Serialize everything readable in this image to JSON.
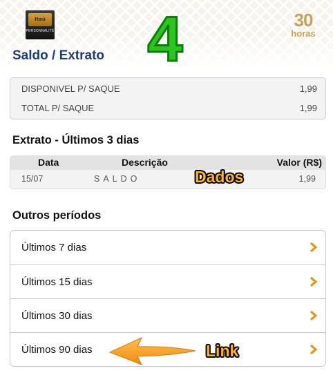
{
  "header": {
    "logo_brand": "Itaú",
    "logo_sub": "PERSONNALITÉ",
    "hours_number": "30",
    "hours_label": "horas",
    "annotation_number": "4"
  },
  "page_title": "Saldo / Extrato",
  "balance": {
    "rows": [
      {
        "label": "DISPONIVEL P/ SAQUE",
        "value": "1,99"
      },
      {
        "label": "TOTAL P/ SAQUE",
        "value": "1,99"
      }
    ]
  },
  "extrato": {
    "title": "Extrato - Últimos 3 dias",
    "columns": {
      "date": "Data",
      "desc": "Descrição",
      "value": "Valor (R$)"
    },
    "rows": [
      {
        "date": "15/07",
        "desc": "SALDO",
        "value": "1,99"
      }
    ]
  },
  "annotations": {
    "dados": "Dados",
    "link": "Link",
    "colors": {
      "callout": "#ffb31a",
      "big_number": "#2ec41f",
      "arrow": "#f7a021"
    }
  },
  "outros": {
    "title": "Outros períodos",
    "items": [
      {
        "label": "Últimos 7 dias"
      },
      {
        "label": "Últimos 15 dias"
      },
      {
        "label": "Últimos 30 dias"
      },
      {
        "label": "Últimos 90 dias"
      }
    ]
  },
  "colors": {
    "title_blue": "#1d3d7a",
    "chevron": "#d99a1e",
    "gold": "#c5a25e"
  }
}
